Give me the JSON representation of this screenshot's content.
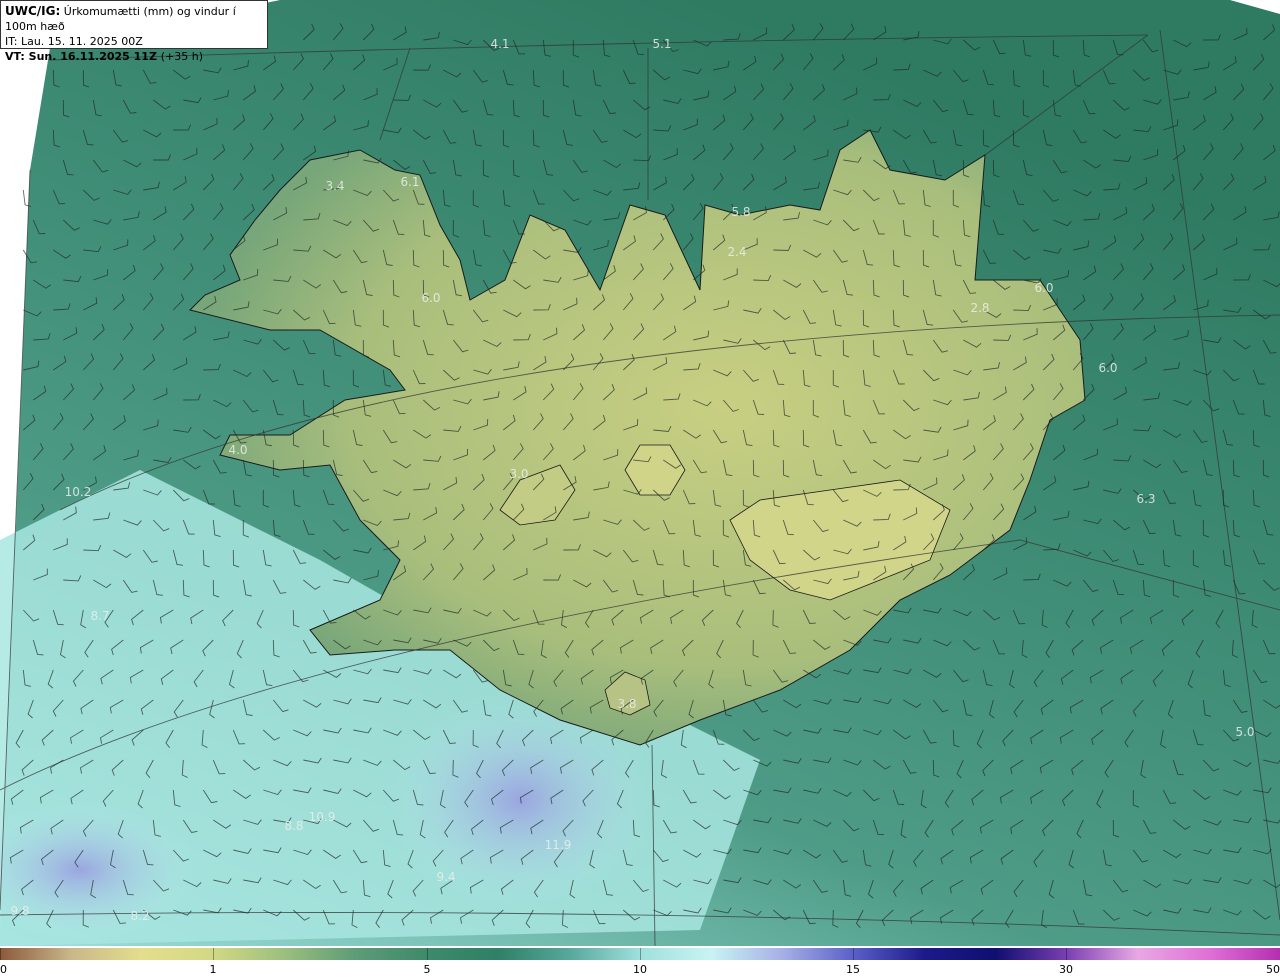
{
  "header": {
    "model": "UWC/IG:",
    "title": "Úrkomumætti (mm) og vindur í 100m hæð",
    "init_label": "IT: Lau. 15. 11. 2025 00Z",
    "valid_label": "VT: Sun. 16.11.2025 11Z",
    "lead_label": "(+35 h)"
  },
  "map_values": [
    "4.1",
    "5.1",
    "3.4",
    "6.1",
    "5.8",
    "2.4",
    "6.0",
    "6.0",
    "2.8",
    "6.0",
    "4.0",
    "3.0",
    "10.2",
    "6.3",
    "8.7",
    "3.8",
    "5.0",
    "10.9",
    "8.8",
    "11.9",
    "9.4",
    "9.8",
    "8.2"
  ],
  "colorbar": {
    "labels": [
      "0",
      "1",
      "5",
      "10",
      "15",
      "30",
      "50"
    ],
    "colors": [
      "#8b5a3c",
      "#c9b78a",
      "#e4de8c",
      "#d2d884",
      "#9bbf7e",
      "#5d9c77",
      "#3e8a6a",
      "#2f8067",
      "#57a79b",
      "#9fe0dc",
      "#c8f3f3",
      "#a6b0e6",
      "#5a60c8",
      "#1c1a8a",
      "#0f0f70",
      "#7a3fb0",
      "#e8a8e4",
      "#e070d6",
      "#b42fb0"
    ]
  }
}
